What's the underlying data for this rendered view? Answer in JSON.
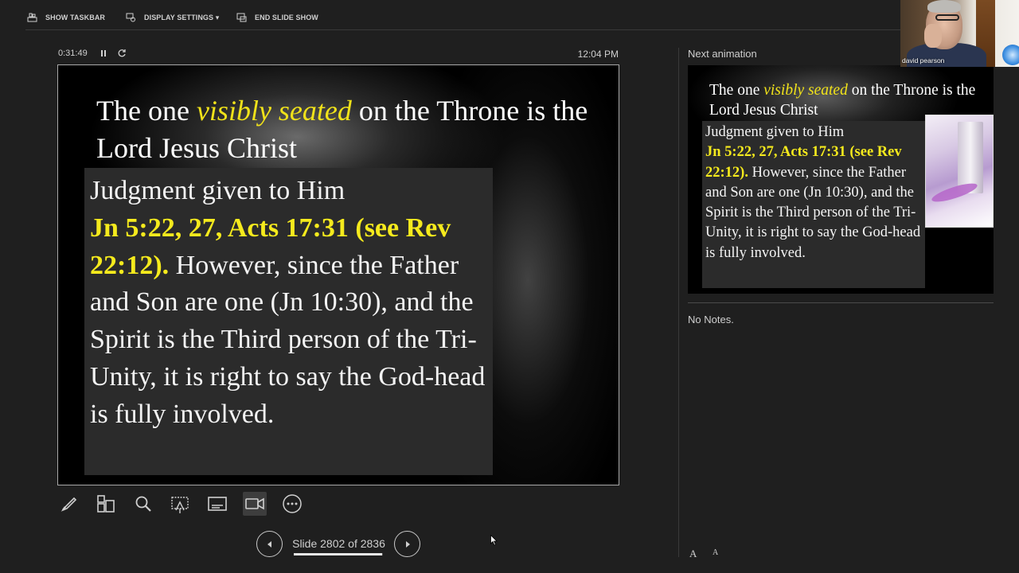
{
  "toolbar": {
    "show_taskbar": "SHOW TASKBAR",
    "display_settings": "DISPLAY SETTINGS ▾",
    "end_slide_show": "END SLIDE SHOW"
  },
  "timer": {
    "elapsed": "0:31:49",
    "clock": "12:04 PM"
  },
  "current_slide": {
    "title_part1": "The one ",
    "title_highlight": "visibly seated",
    "title_part2": " on the Throne is the Lord Jesus Christ",
    "body_line1": "Judgment given to Him",
    "body_refs": "Jn 5:22, 27, Acts 17:31 (see Rev 22:12).",
    "body_rest": " However, since the Father and Son are one (Jn 10:30), and the Spirit is the Third person of the Tri-Unity, it is right to say the God-head is fully involved."
  },
  "tools": [
    {
      "name": "pen-icon"
    },
    {
      "name": "see-all-slides-icon"
    },
    {
      "name": "zoom-icon"
    },
    {
      "name": "pointer-options-icon"
    },
    {
      "name": "subtitles-icon"
    },
    {
      "name": "camera-icon"
    },
    {
      "name": "more-options-icon"
    }
  ],
  "navigation": {
    "counter": "Slide 2802 of 2836",
    "current": 2802,
    "total": 2836,
    "progress": 0.988
  },
  "next": {
    "label": "Next animation",
    "title_part1": "The one ",
    "title_highlight": "visibly seated",
    "title_part2": " on the Throne is the Lord Jesus Christ",
    "body_line1": "Judgment given to Him",
    "body_refs": "Jn 5:22, 27, Acts 17:31 (see Rev 22:12).",
    "body_rest": " However, since the Father and Son are one (Jn 10:30), and the Spirit is the Third person of the Tri-Unity, it is right to say the God-head is fully involved."
  },
  "notes": {
    "text": "No Notes.",
    "font_up": "A",
    "font_down": "A"
  },
  "webcam": {
    "participant_name": "david pearson"
  },
  "colors": {
    "background": "#1f1f1f",
    "highlight_yellow": "#f5ea1d",
    "text_box": "#2b2b2b"
  }
}
